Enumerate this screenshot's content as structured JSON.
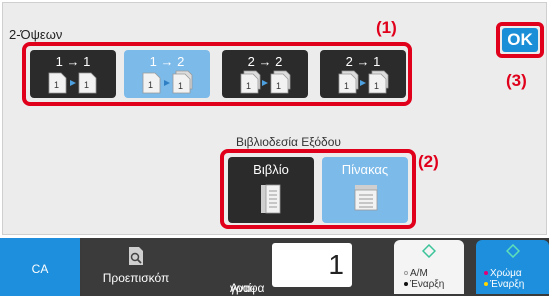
{
  "panel": {
    "title": "2-Όψεων"
  },
  "modes": [
    {
      "label": "1 → 1",
      "selected": false,
      "icon": "simplex-to-simplex-icon"
    },
    {
      "label": "1 → 2",
      "selected": true,
      "icon": "simplex-to-duplex-icon"
    },
    {
      "label": "2 → 2",
      "selected": false,
      "icon": "duplex-to-duplex-icon"
    },
    {
      "label": "2 → 1",
      "selected": false,
      "icon": "duplex-to-simplex-icon"
    }
  ],
  "output": {
    "title": "Βιβλιοδεσία Εξόδου",
    "options": [
      {
        "label": "Βιβλίο",
        "selected": false,
        "icon": "book-binding-icon"
      },
      {
        "label": "Πίνακας",
        "selected": true,
        "icon": "tablet-binding-icon"
      }
    ]
  },
  "ok_label": "OK",
  "callouts": {
    "c1": "(1)",
    "c2": "(2)",
    "c3": "(3)"
  },
  "bottom": {
    "ca": "CA",
    "preview": "Προεπισκόπ",
    "copies_label_line1": "Αντί-",
    "copies_label_line2": "γραφα",
    "copies_value": "1",
    "bw_line1": "A/M",
    "bw_line2": "Έναρξη",
    "color_line1": "Χρώμα",
    "color_line2": "Έναρξη"
  },
  "colors": {
    "accent": "#1e8fdc",
    "highlight": "#e0001b",
    "selected": "#7cbae9"
  }
}
